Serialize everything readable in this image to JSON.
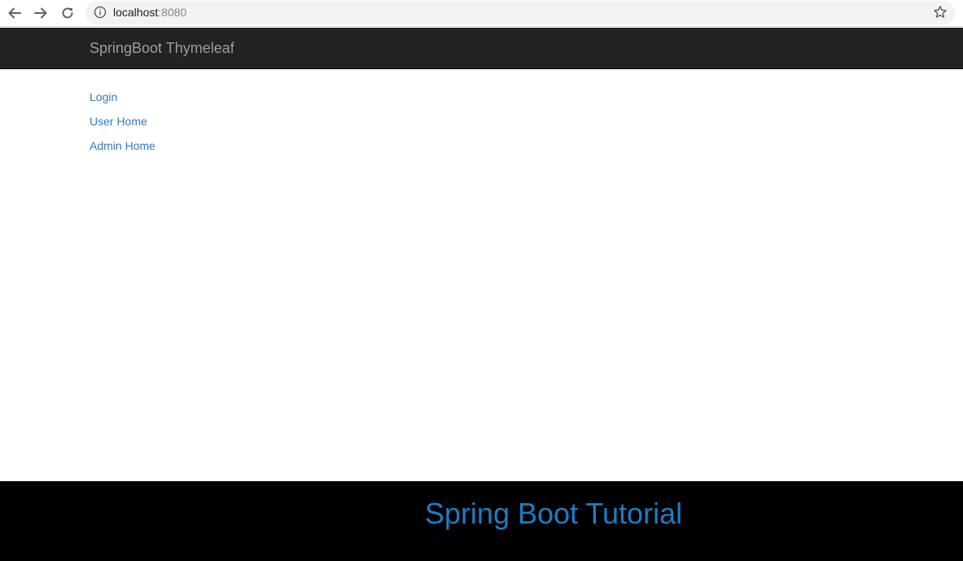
{
  "browser": {
    "url_host": "localhost",
    "url_port": ":8080",
    "back_icon": "arrow-left-icon",
    "forward_icon": "arrow-right-icon",
    "reload_icon": "reload-icon",
    "info_icon": "info-icon",
    "bookmark_icon": "star-icon"
  },
  "navbar": {
    "brand": "SpringBoot Thymeleaf",
    "background": "#222222",
    "brand_color": "#9d9d9d"
  },
  "links": [
    {
      "label": "Login"
    },
    {
      "label": "User Home"
    },
    {
      "label": "Admin Home"
    }
  ],
  "footer": {
    "title": "Spring Boot Tutorial",
    "background": "#000000",
    "title_color": "#1b7ec2"
  },
  "colors": {
    "link": "#337ab7"
  }
}
